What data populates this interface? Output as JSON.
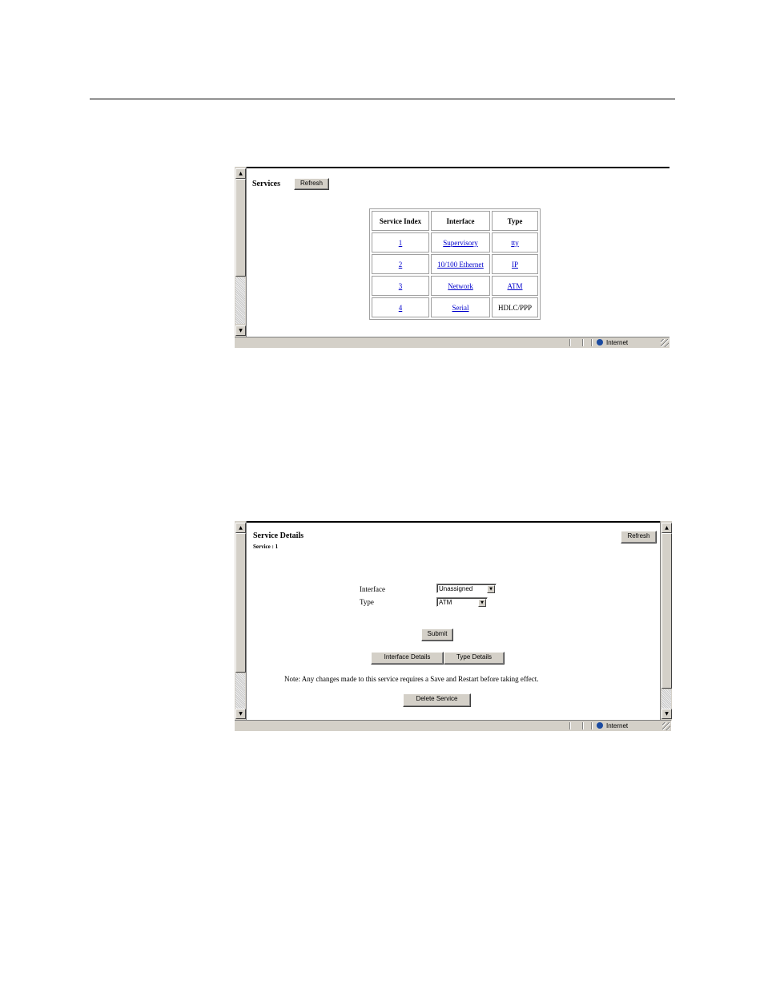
{
  "services_panel": {
    "title": "Services",
    "refresh_label": "Refresh",
    "table": {
      "headers": [
        "Service Index",
        "Interface",
        "Type"
      ],
      "rows": [
        {
          "index": "1",
          "interface": "Supervisory",
          "type": "tty",
          "type_link": true
        },
        {
          "index": "2",
          "interface": "10/100 Ethernet",
          "type": "IP",
          "type_link": true
        },
        {
          "index": "3",
          "interface": "Network",
          "type": "ATM",
          "type_link": true
        },
        {
          "index": "4",
          "interface": "Serial",
          "type": "HDLC/PPP",
          "type_link": false
        }
      ]
    },
    "status_zone": "Internet"
  },
  "details_panel": {
    "title": "Service Details",
    "subtitle": "Service : 1",
    "refresh_label": "Refresh",
    "interface_label": "Interface",
    "interface_value": "Unassigned",
    "type_label": "Type",
    "type_value": "ATM",
    "submit_label": "Submit",
    "interface_details_label": "Interface Details",
    "type_details_label": "Type Details",
    "note": "Note:  Any changes made to this service requires a Save and Restart before taking effect.",
    "delete_label": "Delete Service",
    "status_zone": "Internet"
  },
  "icons": {
    "scroll_up": "▲",
    "scroll_down": "▼",
    "dropdown": "▼"
  }
}
